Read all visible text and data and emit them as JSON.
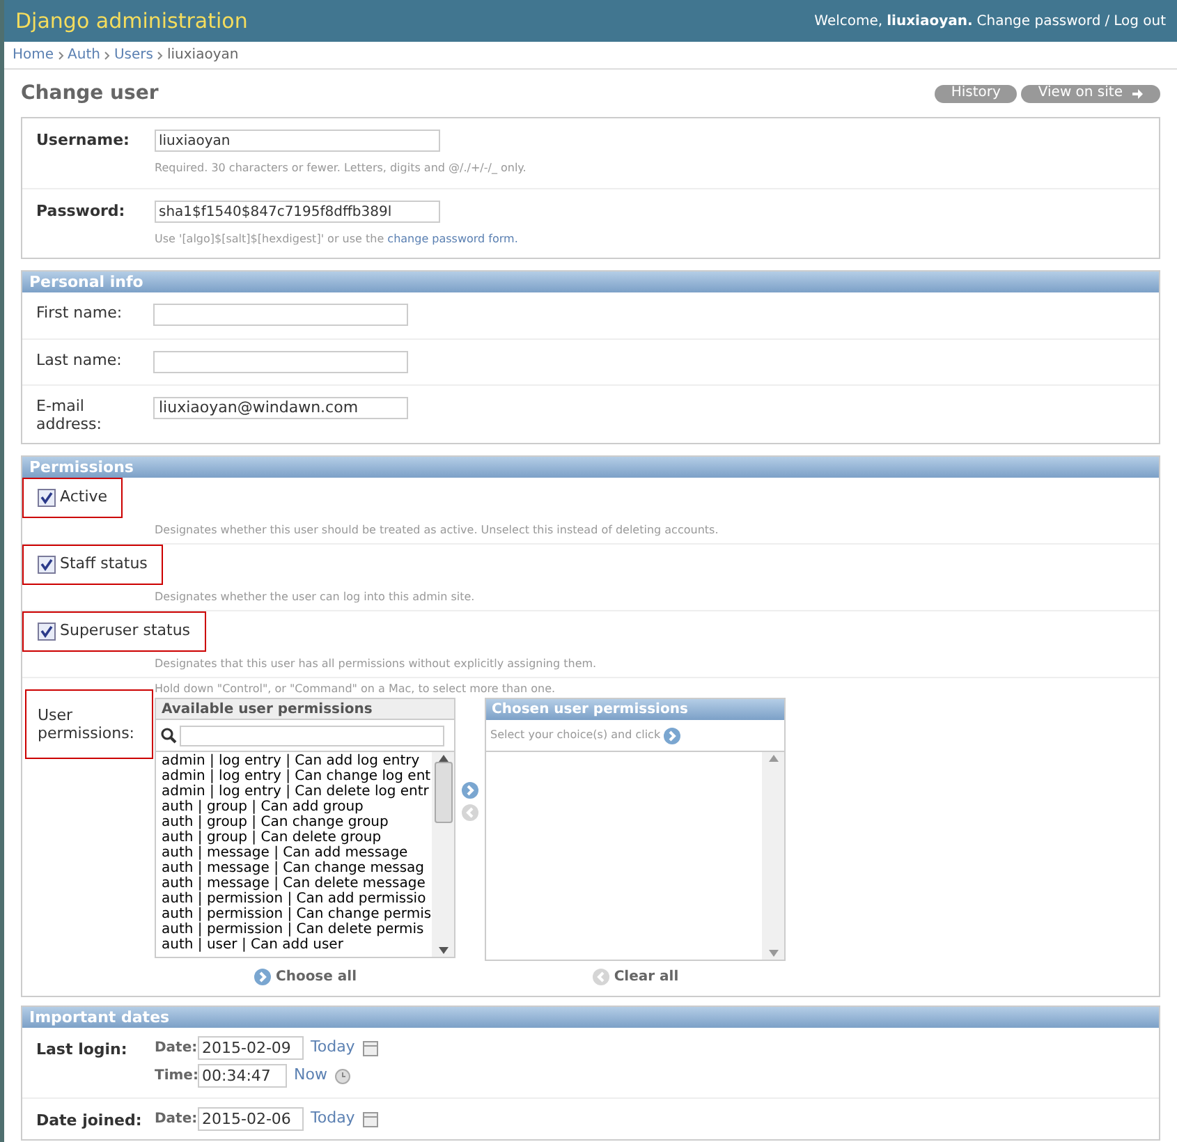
{
  "header": {
    "title": "Django administration",
    "welcome": "Welcome,",
    "user": "liuxiaoyan.",
    "change_password": "Change password",
    "separator": "/",
    "logout": "Log out"
  },
  "breadcrumbs": [
    {
      "label": "Home",
      "link": true
    },
    {
      "label": "Auth",
      "link": true
    },
    {
      "label": "Users",
      "link": true
    },
    {
      "label": "liuxiaoyan",
      "link": false
    }
  ],
  "page_title": "Change user",
  "object_tools": [
    {
      "label": "History",
      "kind": "plain"
    },
    {
      "label": "View on site",
      "kind": "arrow"
    }
  ],
  "account": [
    {
      "label": "Username:",
      "value": "liuxiaoyan",
      "help": "Required. 30 characters or fewer. Letters, digits and @/./+/-/_ only."
    },
    {
      "label": "Password:",
      "value": "sha1$f1540$847c7195f8dffb389l",
      "help": "Use '[algo]$[salt]$[hexdigest]' or use the",
      "help_link": "change password form."
    }
  ],
  "personal_info": {
    "title": "Personal info",
    "fields": [
      {
        "label": "First name:"
      },
      {
        "label": "Last name:"
      },
      {
        "label": "E-mail address:",
        "value": "liuxiaoyan@windawn.com"
      }
    ]
  },
  "permissions": {
    "title": "Permissions",
    "checkboxes": [
      {
        "label": "Active",
        "checked": true,
        "highlighted": true,
        "help": "Designates whether this user should be treated as active. Unselect this instead of deleting accounts."
      },
      {
        "label": "Staff status",
        "checked": true,
        "highlighted": true,
        "help": "Designates whether the user can log into this admin site."
      },
      {
        "label": "Superuser status",
        "checked": true,
        "highlighted": true,
        "help": "Designates that this user has all permissions without explicitly assigning them."
      }
    ],
    "user_permissions": {
      "label": "User permissions:",
      "highlighted": true,
      "help": "Hold down \"Control\", or \"Command\" on a Mac, to select more than one.",
      "available_title": "Available user permissions",
      "available": [
        "admin | log entry | Can add log entry",
        "admin | log entry | Can change log ent",
        "admin | log entry | Can delete log entr",
        "auth | group | Can add group",
        "auth | group | Can change group",
        "auth | group | Can delete group",
        "auth | message | Can add message",
        "auth | message | Can change messag",
        "auth | message | Can delete message",
        "auth | permission | Can add permissio",
        "auth | permission | Can change permis",
        "auth | permission | Can delete permis",
        "auth | user | Can add user"
      ],
      "choose_all": "Choose all",
      "chosen_title": "Chosen user permissions",
      "chosen_help": "Select your choice(s) and click",
      "clear_all": "Clear all"
    }
  },
  "important_dates": {
    "title": "Important dates",
    "rows": [
      {
        "label": "Last login:",
        "date_label": "Date:",
        "date": "2015-02-09",
        "today": "Today",
        "time_label": "Time:",
        "time": "00:34:47",
        "now": "Now"
      },
      {
        "label": "Date joined:",
        "date_label": "Date:",
        "date": "2015-02-06",
        "today": "Today"
      }
    ]
  }
}
